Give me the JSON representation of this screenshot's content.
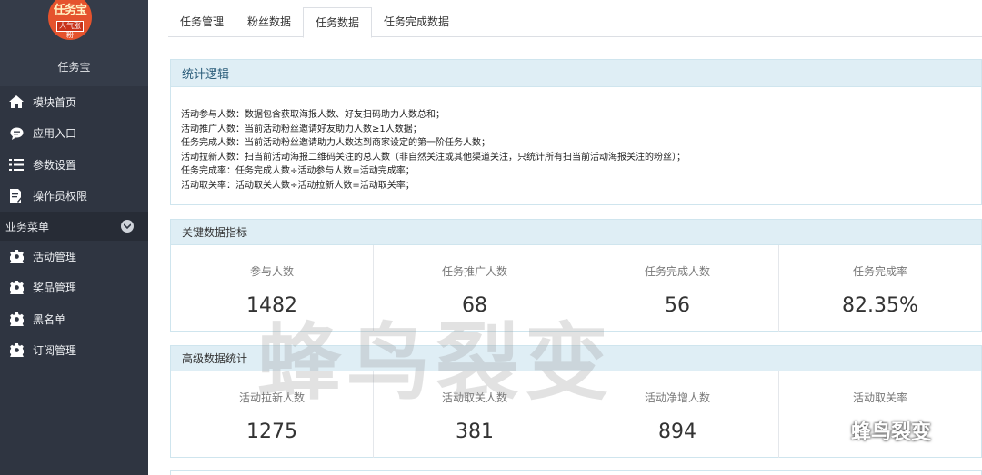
{
  "sidebar": {
    "logo_text_top": "任务宝",
    "logo_text_bottom": "人气涨粉",
    "profile_name": "任务宝",
    "items": [
      {
        "label": "模块首页",
        "icon": "home-icon"
      },
      {
        "label": "应用入口",
        "icon": "chat-icon"
      },
      {
        "label": "参数设置",
        "icon": "list-icon"
      },
      {
        "label": "操作员权限",
        "icon": "document-edit-icon"
      }
    ],
    "section_label": "业务菜单",
    "business_items": [
      {
        "label": "活动管理",
        "icon": "gear-icon"
      },
      {
        "label": "奖品管理",
        "icon": "gear-icon"
      },
      {
        "label": "黑名单",
        "icon": "gear-icon"
      },
      {
        "label": "订阅管理",
        "icon": "gear-icon"
      }
    ]
  },
  "tabs": [
    {
      "label": "任务管理",
      "active": false
    },
    {
      "label": "粉丝数据",
      "active": false
    },
    {
      "label": "任务数据",
      "active": true
    },
    {
      "label": "任务完成数据",
      "active": false
    }
  ],
  "logic": {
    "title": "统计逻辑",
    "lines": [
      "活动参与人数：数据包含获取海报人数、好友扫码助力人数总和；",
      "活动推广人数：当前活动粉丝邀请好友助力人数≥1人数据；",
      "任务完成人数：当前活动粉丝邀请助力人数达到商家设定的第一阶任务人数；",
      "活动拉新人数：扫当前活动海报二维码关注的总人数（非自然关注或其他渠道关注，只统计所有扫当前活动海报关注的粉丝）；",
      "任务完成率：任务完成人数÷活动参与人数=活动完成率；",
      "活动取关率：活动取关人数÷活动拉新人数=活动取关率；"
    ]
  },
  "key_stats": {
    "title": "关键数据指标",
    "items": [
      {
        "label": "参与人数",
        "value": "1482"
      },
      {
        "label": "任务推广人数",
        "value": "68"
      },
      {
        "label": "任务完成人数",
        "value": "56"
      },
      {
        "label": "任务完成率",
        "value": "82.35%"
      }
    ]
  },
  "advanced_stats": {
    "title": "高级数据统计",
    "items": [
      {
        "label": "活动拉新人数",
        "value": "1275"
      },
      {
        "label": "活动取关人数",
        "value": "381"
      },
      {
        "label": "活动净增人数",
        "value": "894"
      },
      {
        "label": "活动取关率",
        "value": ""
      }
    ]
  },
  "watermark": {
    "main_text": "蜂鸟裂变",
    "corner_text": "蜂鸟裂变"
  }
}
